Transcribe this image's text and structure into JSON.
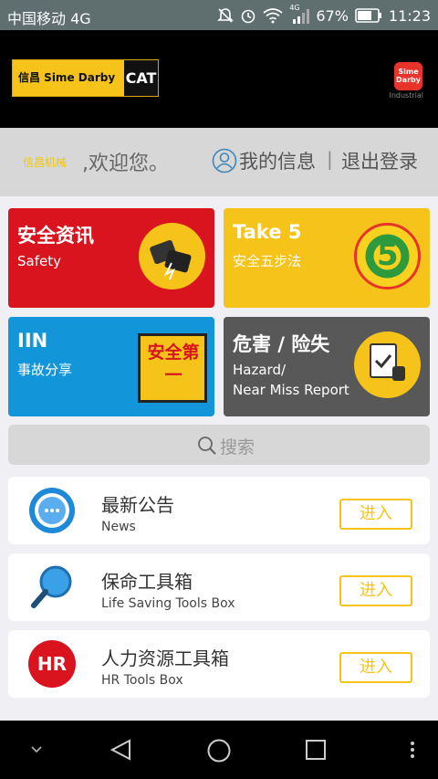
{
  "status_bar": {
    "carrier": "中国移动 4G",
    "network_badge": "4G",
    "battery": "67%",
    "time": "11:23",
    "icons": [
      "mute-icon",
      "alarm-icon",
      "wifi-icon",
      "signal-icon",
      "battery-icon"
    ]
  },
  "header": {
    "brand_text": "信昌 Sime Darby",
    "cat_text": "CAT",
    "sd_logo_text": "Sime Darby",
    "sd_sub_text": "Industrial"
  },
  "welcome": {
    "username": "信昌机械",
    "greeting": ",欢迎您。",
    "my_info": "我的信息",
    "separator": "|",
    "logout": "退出登录"
  },
  "tiles": [
    {
      "title": "安全资讯",
      "subtitle": "Safety",
      "color": "#d9141e"
    },
    {
      "title": "Take 5",
      "subtitle": "安全五步法",
      "color": "#f5c319",
      "badge_text": "5"
    },
    {
      "title": "IIN",
      "subtitle": "事故分享",
      "color": "#1296d9",
      "badge_text": "安全第一"
    },
    {
      "title": "危害 / 险失",
      "subtitle_line1": "Hazard/",
      "subtitle_line2": "Near Miss Report",
      "color": "#585858"
    }
  ],
  "search": {
    "label": "搜索"
  },
  "cards": [
    {
      "title": "最新公告",
      "subtitle": "News",
      "button": "进入"
    },
    {
      "title": "保命工具箱",
      "subtitle": "Life Saving Tools Box",
      "button": "进入"
    },
    {
      "title": "人力资源工具箱",
      "subtitle": "HR Tools Box",
      "button": "进入",
      "icon_text": "HR"
    }
  ],
  "colors": {
    "accent": "#f5c319",
    "red": "#d9141e",
    "blue": "#1296d9",
    "gray": "#585858"
  }
}
